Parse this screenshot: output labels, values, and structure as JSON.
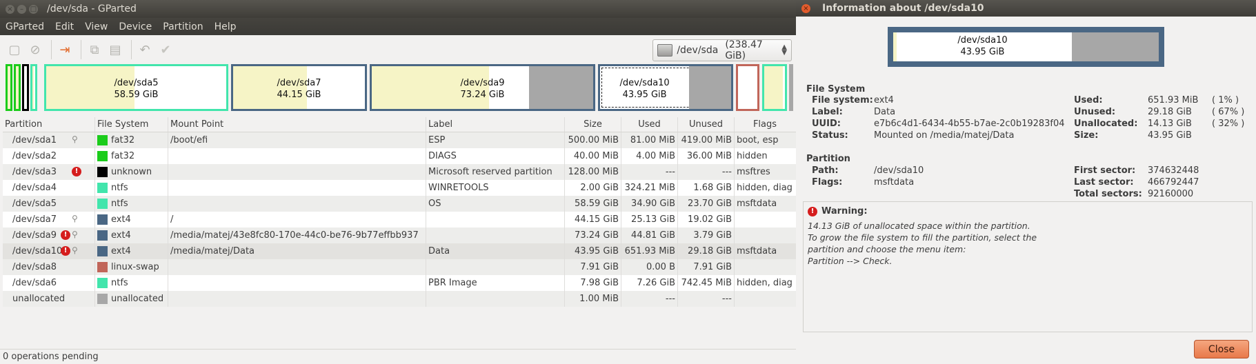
{
  "main_window": {
    "title": "/dev/sda - GParted",
    "menu": [
      "GParted",
      "Edit",
      "View",
      "Device",
      "Partition",
      "Help"
    ],
    "device_selector": {
      "device": "/dev/sda",
      "size": "(238.47 GiB)"
    }
  },
  "colors": {
    "fat32": "#1bcc1b",
    "unknown": "#000000",
    "ntfs": "#42e5ac",
    "ext4": "#4a6784",
    "linux_swap": "#c1665a",
    "unallocated": "#a7a7a7",
    "used": "#f6f4c6"
  },
  "disk_map": [
    {
      "name": "/dev/sda5",
      "size": "58.59 GiB"
    },
    {
      "name": "/dev/sda7",
      "size": "44.15 GiB"
    },
    {
      "name": "/dev/sda9",
      "size": "73.24 GiB"
    },
    {
      "name": "/dev/sda10",
      "size": "43.95 GiB"
    }
  ],
  "table": {
    "headers": {
      "partition": "Partition",
      "fs": "File System",
      "mount": "Mount Point",
      "label": "Label",
      "size": "Size",
      "used": "Used",
      "unused": "Unused",
      "flags": "Flags"
    },
    "rows": [
      {
        "partition": "/dev/sda1",
        "fs": "fat32",
        "fs_color": "#1bcc1b",
        "mount": "/boot/efi",
        "label": "ESP",
        "size": "500.00 MiB",
        "used": "81.00 MiB",
        "unused": "419.00 MiB",
        "flags": "boot, esp",
        "warn": false,
        "key": true
      },
      {
        "partition": "/dev/sda2",
        "fs": "fat32",
        "fs_color": "#1bcc1b",
        "mount": "",
        "label": "DIAGS",
        "size": "40.00 MiB",
        "used": "4.00 MiB",
        "unused": "36.00 MiB",
        "flags": "hidden",
        "warn": false,
        "key": false
      },
      {
        "partition": "/dev/sda3",
        "fs": "unknown",
        "fs_color": "#000000",
        "mount": "",
        "label": "Microsoft reserved partition",
        "size": "128.00 MiB",
        "used": "---",
        "unused": "---",
        "flags": "msftres",
        "warn": true,
        "key": false
      },
      {
        "partition": "/dev/sda4",
        "fs": "ntfs",
        "fs_color": "#42e5ac",
        "mount": "",
        "label": "WINRETOOLS",
        "size": "2.00 GiB",
        "used": "324.21 MiB",
        "unused": "1.68 GiB",
        "flags": "hidden, diag",
        "warn": false,
        "key": false
      },
      {
        "partition": "/dev/sda5",
        "fs": "ntfs",
        "fs_color": "#42e5ac",
        "mount": "",
        "label": "OS",
        "size": "58.59 GiB",
        "used": "34.90 GiB",
        "unused": "23.70 GiB",
        "flags": "msftdata",
        "warn": false,
        "key": false
      },
      {
        "partition": "/dev/sda7",
        "fs": "ext4",
        "fs_color": "#4a6784",
        "mount": "/",
        "label": "",
        "size": "44.15 GiB",
        "used": "25.13 GiB",
        "unused": "19.02 GiB",
        "flags": "",
        "warn": false,
        "key": true
      },
      {
        "partition": "/dev/sda9",
        "fs": "ext4",
        "fs_color": "#4a6784",
        "mount": "/media/matej/43e8fc80-170e-44c0-be76-9b77effbb937",
        "label": "",
        "size": "73.24 GiB",
        "used": "44.81 GiB",
        "unused": "3.79 GiB",
        "flags": "",
        "warn": true,
        "key": true
      },
      {
        "partition": "/dev/sda10",
        "fs": "ext4",
        "fs_color": "#4a6784",
        "mount": "/media/matej/Data",
        "label": "Data",
        "size": "43.95 GiB",
        "used": "651.93 MiB",
        "unused": "29.18 GiB",
        "flags": "msftdata",
        "warn": true,
        "key": true,
        "selected": true
      },
      {
        "partition": "/dev/sda8",
        "fs": "linux-swap",
        "fs_color": "#c1665a",
        "mount": "",
        "label": "",
        "size": "7.91 GiB",
        "used": "0.00 B",
        "unused": "7.91 GiB",
        "flags": "",
        "warn": false,
        "key": false
      },
      {
        "partition": "/dev/sda6",
        "fs": "ntfs",
        "fs_color": "#42e5ac",
        "mount": "",
        "label": "PBR Image",
        "size": "7.98 GiB",
        "used": "7.26 GiB",
        "unused": "742.45 MiB",
        "flags": "hidden, diag",
        "warn": false,
        "key": false
      },
      {
        "partition": "unallocated",
        "fs": "unallocated",
        "fs_color": "#a7a7a7",
        "mount": "",
        "label": "",
        "size": "1.00 MiB",
        "used": "---",
        "unused": "---",
        "flags": "",
        "warn": false,
        "key": false
      }
    ]
  },
  "status": "0 operations pending",
  "dialog": {
    "title": "Information about /dev/sda10",
    "map": {
      "name": "/dev/sda10",
      "size": "43.95 GiB"
    },
    "fs_heading": "File System",
    "fs_left": [
      {
        "k": "File system:",
        "v": "ext4"
      },
      {
        "k": "Label:",
        "v": "Data"
      },
      {
        "k": "UUID:",
        "v": "e7b6c4d1-6434-4b55-b7ae-2c0b19283f04"
      },
      {
        "k": "Status:",
        "v": "Mounted on /media/matej/Data"
      }
    ],
    "fs_right": [
      {
        "k": "Used:",
        "v": "651.93 MiB",
        "p": "( 1% )"
      },
      {
        "k": "Unused:",
        "v": "29.18 GiB",
        "p": "( 67% )"
      },
      {
        "k": "Unallocated:",
        "v": "14.13 GiB",
        "p": "( 32% )"
      },
      {
        "k": "Size:",
        "v": "43.95 GiB",
        "p": ""
      }
    ],
    "part_heading": "Partition",
    "part_left": [
      {
        "k": "Path:",
        "v": "/dev/sda10"
      },
      {
        "k": "Flags:",
        "v": "msftdata"
      }
    ],
    "part_right": [
      {
        "k": "First sector:",
        "v": "374632448"
      },
      {
        "k": "Last sector:",
        "v": "466792447"
      },
      {
        "k": "Total sectors:",
        "v": "92160000"
      }
    ],
    "warning_heading": "Warning:",
    "warning_text": "14.13 GiB of unallocated space within the partition.\nTo grow the file system to fill the partition, select the\npartition and choose the menu item:\nPartition --> Check.",
    "close_label": "Close"
  }
}
